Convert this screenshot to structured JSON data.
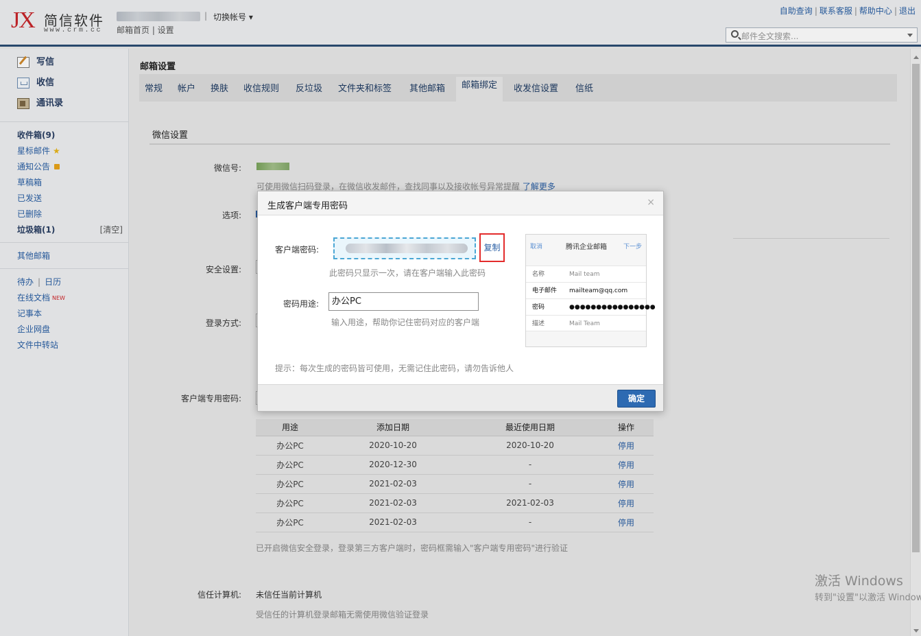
{
  "header": {
    "logo_mark": "JX",
    "logo_name": "简信软件",
    "logo_url": "www.crm.cc",
    "account_sep": "|",
    "switch_account": "切换帐号 ▾",
    "breadcrumb": "邮箱首页 | 设置",
    "top_links": [
      "自助查询",
      "联系客服",
      "帮助中心",
      "退出"
    ],
    "search_placeholder": "邮件全文搜索..."
  },
  "sidebar": {
    "primary": [
      {
        "label": "写信",
        "icon": "compose-icon"
      },
      {
        "label": "收信",
        "icon": "inbox-icon"
      },
      {
        "label": "通讯录",
        "icon": "address-book-icon"
      }
    ],
    "folders": [
      {
        "label": "收件箱(9)",
        "bold": true
      },
      {
        "label": "星标邮件",
        "badge": "★"
      },
      {
        "label": "通知公告"
      },
      {
        "label": "草稿箱"
      },
      {
        "label": "已发送"
      },
      {
        "label": "已删除"
      },
      {
        "label": "垃圾箱(1)",
        "bold": true,
        "action": "[清空]"
      }
    ],
    "other_mail": "其他邮箱",
    "tools": {
      "todo": "待办",
      "calendar": "日历",
      "online_docs": "在线文档",
      "new_badge": "NEW",
      "notes": "记事本",
      "netdisk": "企业网盘",
      "transfer": "文件中转站"
    }
  },
  "main": {
    "title": "邮箱设置",
    "tabs": [
      "常规",
      "帐户",
      "换肤",
      "收信规则",
      "反垃圾",
      "文件夹和标签",
      "其他邮箱",
      "邮箱绑定",
      "收发信设置",
      "信纸"
    ],
    "active_tab": "邮箱绑定",
    "section_title": "微信设置",
    "labels": {
      "wechat": "微信号:",
      "options": "选项:",
      "security": "安全设置:",
      "login": "登录方式:",
      "client_pw": "客户端专用密码:",
      "trusted": "信任计算机:"
    },
    "wechat_desc": "可使用微信扫码登录，在微信收发邮件，查找同事以及接收帐号异常提醒",
    "learn_more": "了解更多",
    "table": {
      "headers": [
        "用途",
        "添加日期",
        "最近使用日期",
        "操作"
      ],
      "rows": [
        [
          "办公PC",
          "2020-10-20",
          "2020-10-20",
          "停用"
        ],
        [
          "办公PC",
          "2020-12-30",
          "-",
          "停用"
        ],
        [
          "办公PC",
          "2021-02-03",
          "-",
          "停用"
        ],
        [
          "办公PC",
          "2021-02-03",
          "2021-02-03",
          "停用"
        ],
        [
          "办公PC",
          "2021-02-03",
          "-",
          "停用"
        ]
      ]
    },
    "table_note": "已开启微信安全登录，登录第三方客户端时，密码框需输入\"客户端专用密码\"进行验证",
    "trusted_value": "未信任当前计算机",
    "trusted_note": "受信任的计算机登录邮箱无需使用微信验证登录"
  },
  "dialog": {
    "title": "生成客户端专用密码",
    "close": "×",
    "pw_label": "客户端密码:",
    "copy": "复制",
    "pw_note": "此密码只显示一次，请在客户端输入此密码",
    "use_label": "密码用途:",
    "use_value": "办公PC",
    "use_note": "输入用途，帮助你记住密码对应的客户端",
    "tip": "提示：每次生成的密码皆可使用，无需记住此密码，请勿告诉他人",
    "ok": "确定",
    "phone": {
      "cancel": "取消",
      "title": "腾讯企业邮箱",
      "next": "下一步",
      "rows": [
        {
          "k": "名称",
          "v": "Mail team"
        },
        {
          "k": "电子邮件",
          "v": "mailteam@qq.com"
        },
        {
          "k": "密码",
          "v": "●●●●●●●●●●●●●●●●"
        },
        {
          "k": "描述",
          "v": "Mail Team"
        }
      ]
    }
  },
  "watermark": {
    "line1": "激活 Windows",
    "line2": "转到\"设置\"以激活 Windows。"
  },
  "colors": {
    "header_border": "#2b4d73",
    "link": "#2a5fa4",
    "primary_button": "#2d6ab2",
    "highlight": "#e32b2b",
    "logo_red": "#c8262b"
  }
}
